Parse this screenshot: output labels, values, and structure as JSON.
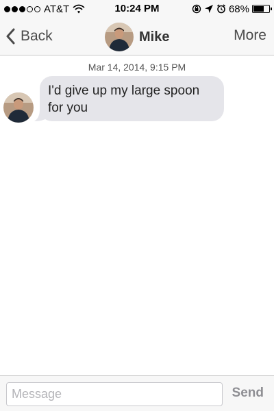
{
  "status_bar": {
    "signal_filled": 3,
    "signal_total": 5,
    "carrier": "AT&T",
    "time": "10:24 PM",
    "icons": [
      "wifi-icon",
      "rotation-lock-icon",
      "location-icon",
      "alarm-icon"
    ],
    "battery_percent": "68%",
    "battery_level": 0.68
  },
  "nav": {
    "back_label": "Back",
    "contact_name": "Mike",
    "more_label": "More",
    "back_icon": "chevron-left-icon"
  },
  "conversation": {
    "timestamp": "Mar 14, 2014, 9:15 PM",
    "messages": [
      {
        "text": "I'd give up my large spoon for you"
      }
    ]
  },
  "composer": {
    "placeholder": "Message",
    "value": "",
    "send_label": "Send"
  },
  "colors": {
    "bar_background": "#f7f7f7",
    "bubble_incoming": "#e5e5ea",
    "send_disabled": "#8e8e93"
  }
}
